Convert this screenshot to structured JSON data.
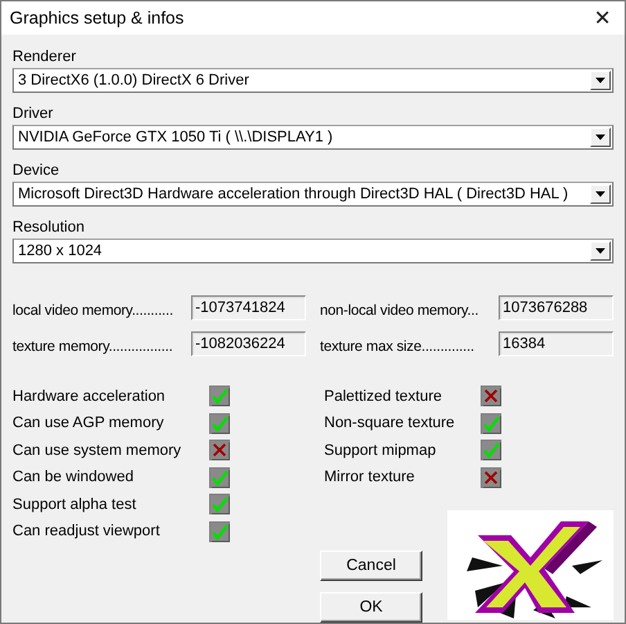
{
  "window": {
    "title": "Graphics setup & infos",
    "close": "✕"
  },
  "selects": [
    {
      "label": "Renderer",
      "value": "3 DirectX6 (1.0.0) DirectX 6 Driver"
    },
    {
      "label": "Driver",
      "value": "NVIDIA GeForce GTX 1050 Ti ( \\\\.\\DISPLAY1 )"
    },
    {
      "label": "Device",
      "value": "Microsoft Direct3D Hardware acceleration through Direct3D HAL ( Direct3D HAL )"
    },
    {
      "label": "Resolution",
      "value": "1280 x 1024"
    }
  ],
  "memory": [
    {
      "label": "local video memory...........",
      "value": "-1073741824"
    },
    {
      "label": "non-local video memory...",
      "value": "1073676288"
    },
    {
      "label": "texture memory.................",
      "value": "-1082036224"
    },
    {
      "label": "texture max size..............",
      "value": "16384"
    }
  ],
  "capabilities_left": [
    {
      "label": "Hardware acceleration",
      "checked": true
    },
    {
      "label": "Can use AGP memory",
      "checked": true
    },
    {
      "label": "Can use system memory",
      "checked": false
    },
    {
      "label": "Can be windowed",
      "checked": true
    },
    {
      "label": "Support alpha test",
      "checked": true
    },
    {
      "label": "Can readjust viewport",
      "checked": true
    }
  ],
  "capabilities_right": [
    {
      "label": "Palettized texture",
      "checked": false
    },
    {
      "label": "Non-square texture",
      "checked": true
    },
    {
      "label": "Support mipmap",
      "checked": true
    },
    {
      "label": "Mirror texture",
      "checked": false
    }
  ],
  "buttons": [
    "Cancel",
    "OK"
  ]
}
